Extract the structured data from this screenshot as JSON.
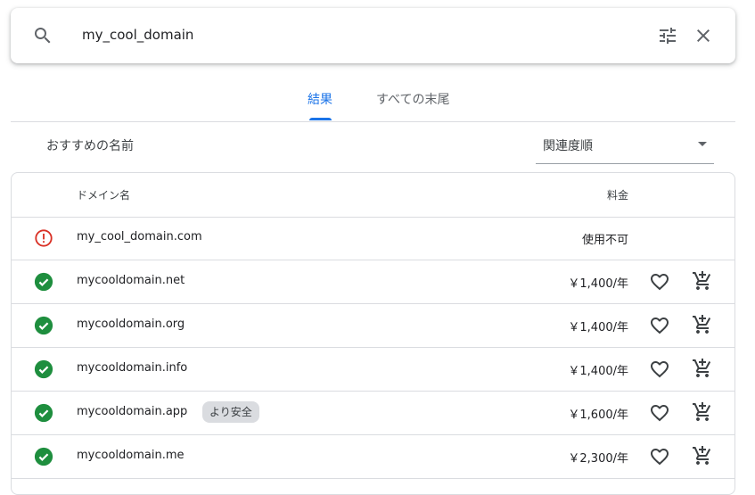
{
  "search": {
    "query": "my_cool_domain"
  },
  "tabs": [
    {
      "label": "結果",
      "active": true
    },
    {
      "label": "すべての末尾",
      "active": false
    }
  ],
  "recommendations_label": "おすすめの名前",
  "sort": {
    "selected": "関連度順"
  },
  "table": {
    "headers": {
      "domain": "ドメイン名",
      "price": "料金"
    },
    "rows": [
      {
        "domain": "my_cool_domain.com",
        "status": "unavailable",
        "price": "使用不可",
        "badge": ""
      },
      {
        "domain": "mycooldomain.net",
        "status": "available",
        "price": "￥1,400/年",
        "badge": ""
      },
      {
        "domain": "mycooldomain.org",
        "status": "available",
        "price": "￥1,400/年",
        "badge": ""
      },
      {
        "domain": "mycooldomain.info",
        "status": "available",
        "price": "￥1,400/年",
        "badge": ""
      },
      {
        "domain": "mycooldomain.app",
        "status": "available",
        "price": "￥1,600/年",
        "badge": "より安全"
      },
      {
        "domain": "mycooldomain.me",
        "status": "available",
        "price": "￥2,300/年",
        "badge": ""
      }
    ]
  },
  "colors": {
    "accent": "#1a73e8",
    "available": "#1e8e3e",
    "unavailable": "#d93025"
  },
  "icons": {
    "search": "search-icon",
    "filter": "tune-icon",
    "close": "close-icon",
    "available": "check-circle-icon",
    "unavailable": "error-icon",
    "favorite": "heart-outline-icon",
    "cart": "add-shopping-cart-icon"
  }
}
